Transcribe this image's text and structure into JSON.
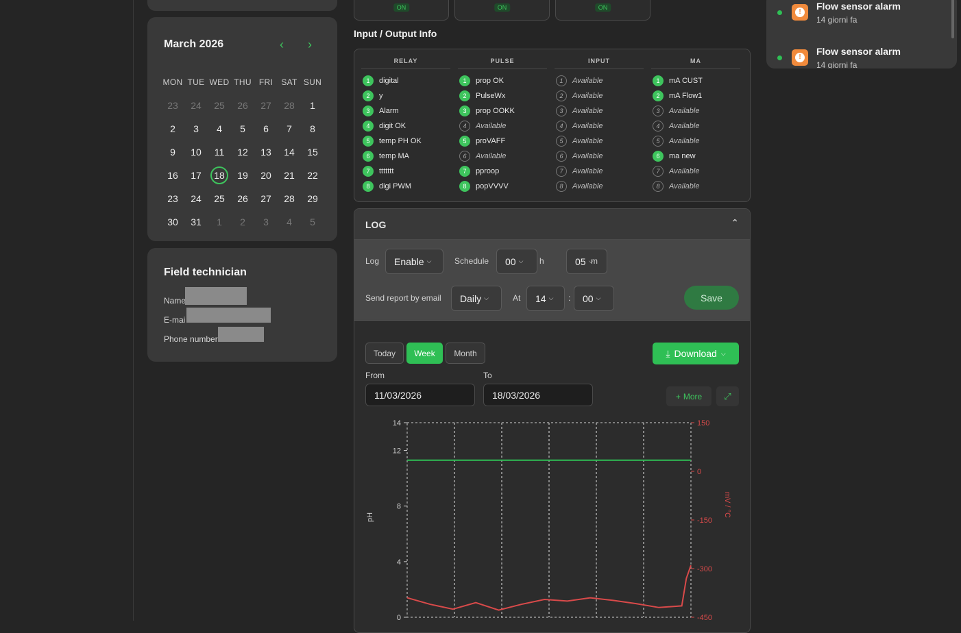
{
  "tiles": [
    {
      "status": "ON"
    },
    {
      "status": "ON"
    },
    {
      "status": "ON"
    }
  ],
  "calendar": {
    "title": "March 2026",
    "prev_icon": "chevron-left-icon",
    "next_icon": "chevron-right-icon",
    "weekdays": [
      "MON",
      "TUE",
      "WED",
      "THU",
      "FRI",
      "SAT",
      "SUN"
    ],
    "weeks": [
      [
        {
          "d": "23",
          "m": true
        },
        {
          "d": "24",
          "m": true
        },
        {
          "d": "25",
          "m": true
        },
        {
          "d": "26",
          "m": true
        },
        {
          "d": "27",
          "m": true
        },
        {
          "d": "28",
          "m": true
        },
        {
          "d": "1"
        }
      ],
      [
        {
          "d": "2"
        },
        {
          "d": "3"
        },
        {
          "d": "4"
        },
        {
          "d": "5"
        },
        {
          "d": "6"
        },
        {
          "d": "7"
        },
        {
          "d": "8"
        }
      ],
      [
        {
          "d": "9"
        },
        {
          "d": "10"
        },
        {
          "d": "11"
        },
        {
          "d": "12"
        },
        {
          "d": "13"
        },
        {
          "d": "14"
        },
        {
          "d": "15"
        }
      ],
      [
        {
          "d": "16"
        },
        {
          "d": "17"
        },
        {
          "d": "18",
          "today": true
        },
        {
          "d": "19"
        },
        {
          "d": "20"
        },
        {
          "d": "21"
        },
        {
          "d": "22"
        }
      ],
      [
        {
          "d": "23"
        },
        {
          "d": "24"
        },
        {
          "d": "25"
        },
        {
          "d": "26"
        },
        {
          "d": "27"
        },
        {
          "d": "28"
        },
        {
          "d": "29"
        }
      ],
      [
        {
          "d": "30"
        },
        {
          "d": "31"
        },
        {
          "d": "1",
          "m": true
        },
        {
          "d": "2",
          "m": true
        },
        {
          "d": "3",
          "m": true
        },
        {
          "d": "4",
          "m": true
        },
        {
          "d": "5",
          "m": true
        }
      ]
    ]
  },
  "technician": {
    "title": "Field technician",
    "name_label": "Name",
    "email_label": "E-mai",
    "phone_label": "Phone number"
  },
  "io": {
    "title": "Input / Output Info",
    "columns": [
      {
        "header": "RELAY",
        "items": [
          {
            "n": "1",
            "label": "digital",
            "active": true
          },
          {
            "n": "2",
            "label": "y",
            "active": true
          },
          {
            "n": "3",
            "label": "Alarm",
            "active": true
          },
          {
            "n": "4",
            "label": "digit OK",
            "active": true
          },
          {
            "n": "5",
            "label": "temp PH OK",
            "active": true
          },
          {
            "n": "6",
            "label": "temp MA",
            "active": true
          },
          {
            "n": "7",
            "label": "ttttttt",
            "active": true
          },
          {
            "n": "8",
            "label": "digi PWM",
            "active": true
          }
        ]
      },
      {
        "header": "PULSE",
        "items": [
          {
            "n": "1",
            "label": "prop OK",
            "active": true
          },
          {
            "n": "2",
            "label": "PulseWx",
            "active": true
          },
          {
            "n": "3",
            "label": "prop OOKK",
            "active": true
          },
          {
            "n": "4",
            "label": "Available",
            "active": false
          },
          {
            "n": "5",
            "label": "proVAFF",
            "active": true
          },
          {
            "n": "6",
            "label": "Available",
            "active": false
          },
          {
            "n": "7",
            "label": "pproop",
            "active": true
          },
          {
            "n": "8",
            "label": "popVVVV",
            "active": true
          }
        ]
      },
      {
        "header": "INPUT",
        "items": [
          {
            "n": "1",
            "label": "Available",
            "active": false
          },
          {
            "n": "2",
            "label": "Available",
            "active": false
          },
          {
            "n": "3",
            "label": "Available",
            "active": false
          },
          {
            "n": "4",
            "label": "Available",
            "active": false
          },
          {
            "n": "5",
            "label": "Available",
            "active": false
          },
          {
            "n": "6",
            "label": "Available",
            "active": false
          },
          {
            "n": "7",
            "label": "Available",
            "active": false
          },
          {
            "n": "8",
            "label": "Available",
            "active": false
          }
        ]
      },
      {
        "header": "MA",
        "items": [
          {
            "n": "1",
            "label": "mA CUST",
            "active": true
          },
          {
            "n": "2",
            "label": "mA Flow1",
            "active": true
          },
          {
            "n": "3",
            "label": "Available",
            "active": false
          },
          {
            "n": "4",
            "label": "Available",
            "active": false
          },
          {
            "n": "5",
            "label": "Available",
            "active": false
          },
          {
            "n": "6",
            "label": "ma new",
            "active": true
          },
          {
            "n": "7",
            "label": "Available",
            "active": false
          },
          {
            "n": "8",
            "label": "Available",
            "active": false
          }
        ]
      }
    ]
  },
  "log": {
    "title": "LOG",
    "collapse_icon": "chevron-up-icon",
    "log_label": "Log",
    "log_value": "Enable",
    "schedule_label": "Schedule",
    "schedule_h": "00",
    "h_unit": "h",
    "schedule_m": "05",
    "m_unit": "m",
    "email_label": "Send report by email",
    "email_freq": "Daily",
    "at_label": "At",
    "at_h": "14",
    "colon": ":",
    "at_m": "00",
    "save_label": "Save",
    "ranges": [
      "Today",
      "Week",
      "Month"
    ],
    "active_range": "Week",
    "download_label": "Download",
    "from_label": "From",
    "from_value": "11/03/2026",
    "to_label": "To",
    "to_value": "18/03/2026",
    "more_label": "More",
    "expand_icon": "expand-icon"
  },
  "chart_data": {
    "type": "line",
    "ylabel": "pH",
    "y2label": "mV / °C",
    "y_ticks": [
      0,
      4,
      8,
      12,
      14
    ],
    "y2_ticks": [
      150,
      0,
      -150,
      -300,
      -450
    ],
    "ylim": [
      0,
      14
    ],
    "y2lim": [
      -450,
      150
    ],
    "x": [
      0,
      0.5,
      1,
      1.5,
      2,
      2.5,
      3,
      3.5,
      4,
      4.5,
      5,
      5.5,
      6,
      6.1,
      6.2
    ],
    "series": [
      {
        "axis": "y",
        "color": "#2fbf55",
        "values": [
          11.3,
          11.3,
          11.3,
          11.3,
          11.3,
          11.3,
          11.3,
          11.3,
          11.3,
          11.3,
          11.3,
          11.3,
          11.3,
          11.3,
          11.3
        ]
      },
      {
        "axis": "y2",
        "color": "#d94a4a",
        "values": [
          -390,
          -410,
          -425,
          -405,
          -428,
          -410,
          -395,
          -400,
          -390,
          -398,
          -408,
          -420,
          -415,
          -330,
          -290
        ]
      }
    ],
    "colors": {
      "left_axis": "#cfcfcf",
      "right_axis": "#d94a4a"
    }
  },
  "notifications": [
    {
      "title": "Flow sensor alarm",
      "time": "14 giorni fa",
      "icon": "alert-icon"
    },
    {
      "title": "Flow sensor alarm",
      "time": "14 giorni fa",
      "icon": "alert-icon"
    }
  ]
}
